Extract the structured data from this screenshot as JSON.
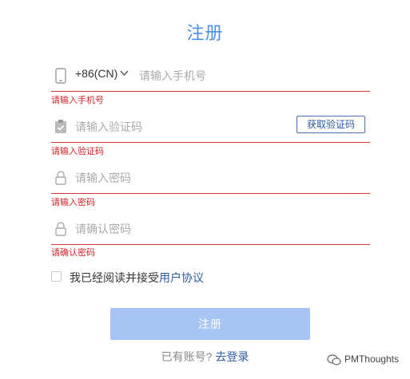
{
  "title": "注册",
  "phone": {
    "country_code": "+86(CN)",
    "placeholder": "请输入手机号",
    "error": "请输入手机号"
  },
  "code": {
    "placeholder": "请输入验证码",
    "button_label": "获取验证码",
    "error": "请输入验证码"
  },
  "password": {
    "placeholder": "请输入密码",
    "error": "请输入密码"
  },
  "confirm": {
    "placeholder": "请确认密码",
    "error": "请确认密码"
  },
  "agreement": {
    "text": "我已经阅读并接受",
    "link": "用户协议"
  },
  "submit_label": "注册",
  "login": {
    "prompt": "已有账号?",
    "link": "去登录"
  },
  "watermark": "PMThoughts",
  "colors": {
    "accent": "#4a90e2",
    "error": "#d6232b",
    "button_disabled": "#a7c4f5",
    "link": "#2c5aa0"
  }
}
